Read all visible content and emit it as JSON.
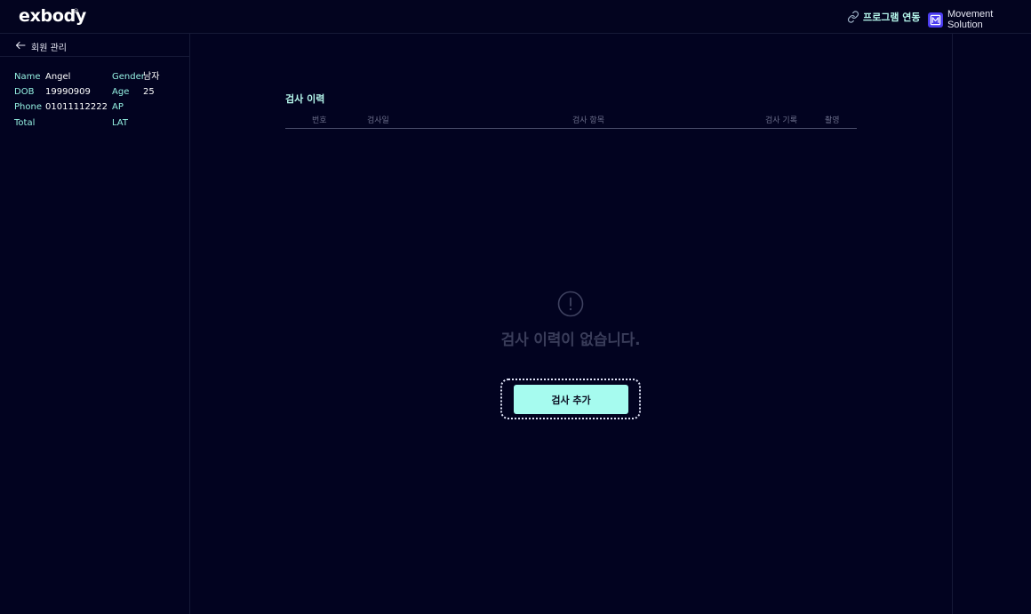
{
  "app": {
    "logo_text": "exbody",
    "logo_mark": "®",
    "program_link_label": "프로그램 연동",
    "partner_label": "Movement Solution",
    "colors": {
      "background": "#020320",
      "accent": "#a6fbef",
      "label_accent": "#95f2e3",
      "partner_logo": "#4b3cf0"
    }
  },
  "sidebar": {
    "back_label": "회원 관리",
    "member": {
      "name_label": "Name",
      "name_value": "Angel",
      "gender_label": "Gender",
      "gender_value": "남자",
      "dob_label": "DOB",
      "dob_value": "19990909",
      "age_label": "Age",
      "age_value": "25",
      "phone_label": "Phone",
      "phone_value": "01011112222",
      "ap_label": "AP",
      "ap_value": "",
      "total_label": "Total",
      "total_value": "",
      "lat_label": "LAT",
      "lat_value": ""
    }
  },
  "main": {
    "section_title": "검사 이력",
    "columns": [
      "번호",
      "검사일",
      "검사 항목",
      "검사 기록",
      "촬영"
    ],
    "empty_message": "검사 이력이 없습니다.",
    "add_button_label": "검사 추가"
  },
  "icons": {
    "back": "arrow-left-icon",
    "program_link": "link-icon",
    "partner": "movement-solution-logo-icon",
    "empty": "exclamation-circle-icon"
  }
}
